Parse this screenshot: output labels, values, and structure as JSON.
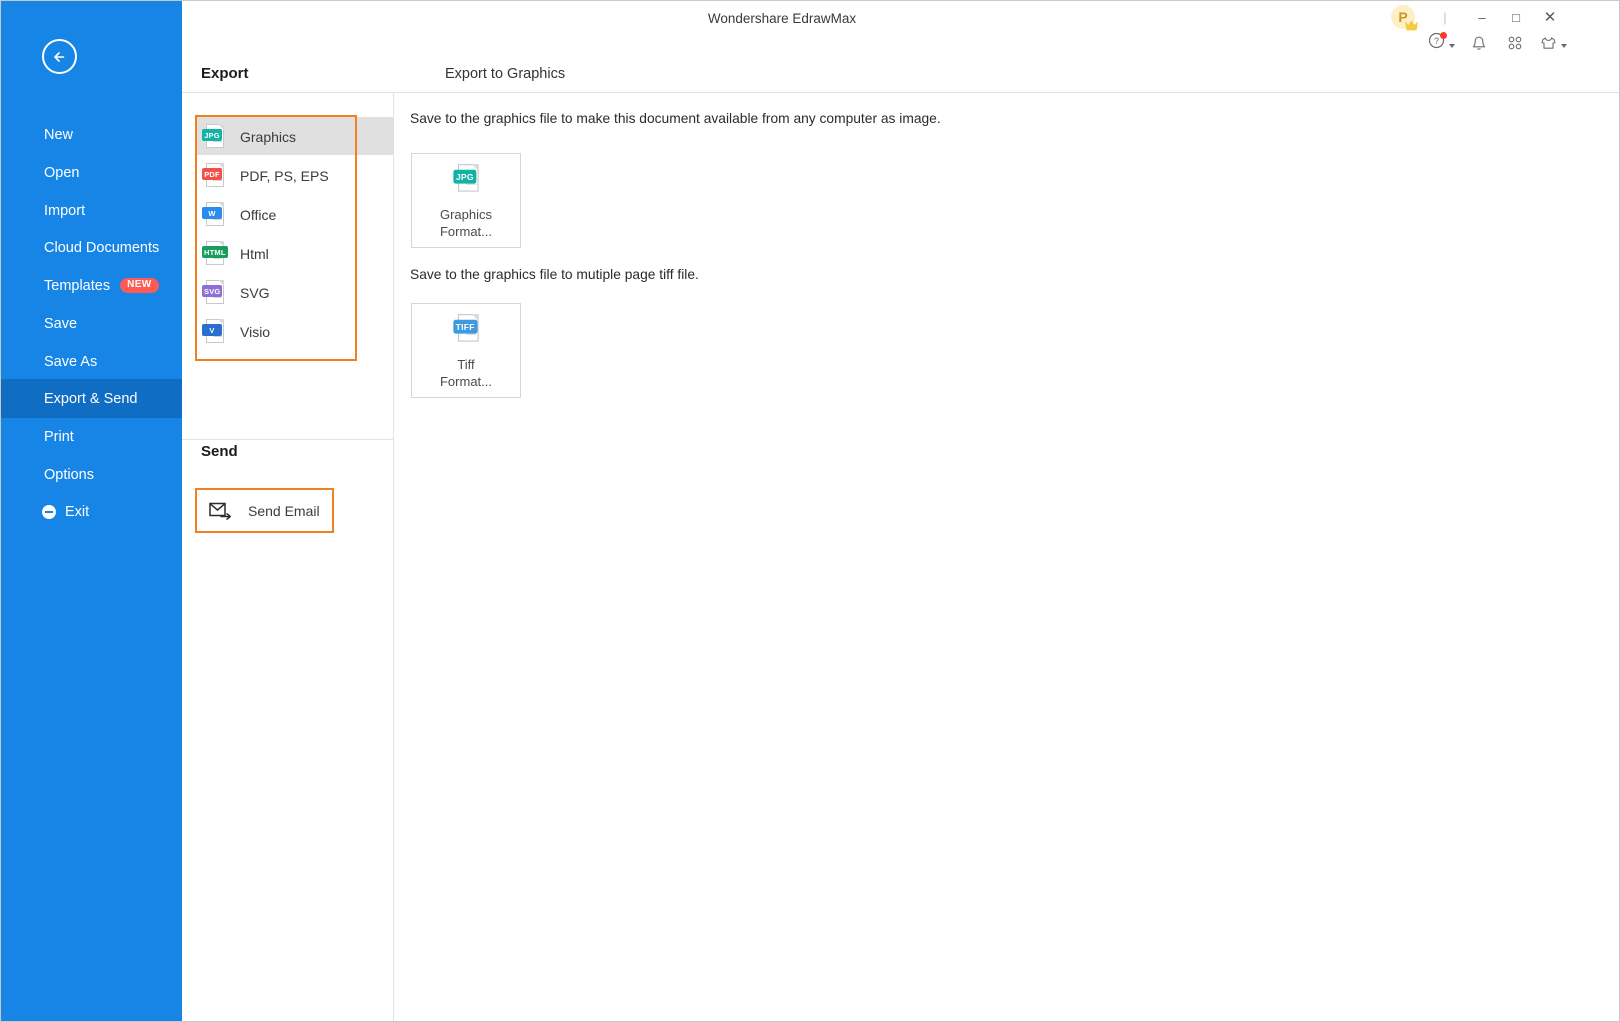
{
  "window": {
    "title": "Wondershare EdrawMax",
    "avatar_letter": "P",
    "controls": {
      "separator": "|",
      "minimize": "–",
      "maximize": "□",
      "close": "✕"
    },
    "tray": {
      "help": "?",
      "bell": "bell-icon",
      "grid": "grid-icon",
      "theme": "theme-shirt-icon"
    }
  },
  "sidebar": {
    "back_label": "back-arrow",
    "items": [
      {
        "label": "New",
        "active": false
      },
      {
        "label": "Open",
        "active": false
      },
      {
        "label": "Import",
        "active": false
      },
      {
        "label": "Cloud Documents",
        "active": false
      },
      {
        "label": "Templates",
        "active": false,
        "badge": "NEW"
      },
      {
        "label": "Save",
        "active": false
      },
      {
        "label": "Save As",
        "active": false
      },
      {
        "label": "Export & Send",
        "active": true
      },
      {
        "label": "Print",
        "active": false
      },
      {
        "label": "Options",
        "active": false
      },
      {
        "label": "Exit",
        "active": false,
        "icon": "exit-icon"
      }
    ]
  },
  "panel": {
    "export_heading": "Export",
    "send_heading": "Send",
    "page_heading": "Export to Graphics",
    "export_items": [
      {
        "label": "Graphics",
        "tag": "JPG",
        "color": "#11b3a4",
        "selected": true
      },
      {
        "label": "PDF, PS, EPS",
        "tag": "PDF",
        "color": "#f4504a",
        "selected": false
      },
      {
        "label": "Office",
        "tag": "W",
        "color": "#2b8bef",
        "selected": false
      },
      {
        "label": "Html",
        "tag": "HTML",
        "color": "#1a9e5e",
        "selected": false
      },
      {
        "label": "SVG",
        "tag": "SVG",
        "color": "#8e6fd8",
        "selected": false
      },
      {
        "label": "Visio",
        "tag": "V",
        "color": "#2b6fd0",
        "selected": false
      }
    ],
    "send_items": [
      {
        "label": "Send Email",
        "icon": "send-email-icon"
      }
    ]
  },
  "content": {
    "desc_1": "Save to the graphics file to make this document available from any computer as image.",
    "desc_2": "Save to the graphics file to mutiple page tiff file.",
    "cards": [
      {
        "caption_line1": "Graphics",
        "caption_line2": "Format...",
        "tag": "JPG",
        "color": "#11b3a4"
      },
      {
        "caption_line1": "Tiff",
        "caption_line2": "Format...",
        "tag": "TIFF",
        "color": "#3d9ae0"
      }
    ]
  },
  "theme": {
    "sidebar_blue": "#1685e6",
    "sidebar_active_blue": "#0f6dc4",
    "highlight_orange": "#f08022",
    "selected_gray": "#e0e0e0",
    "badge_red": "#fd5a54"
  }
}
